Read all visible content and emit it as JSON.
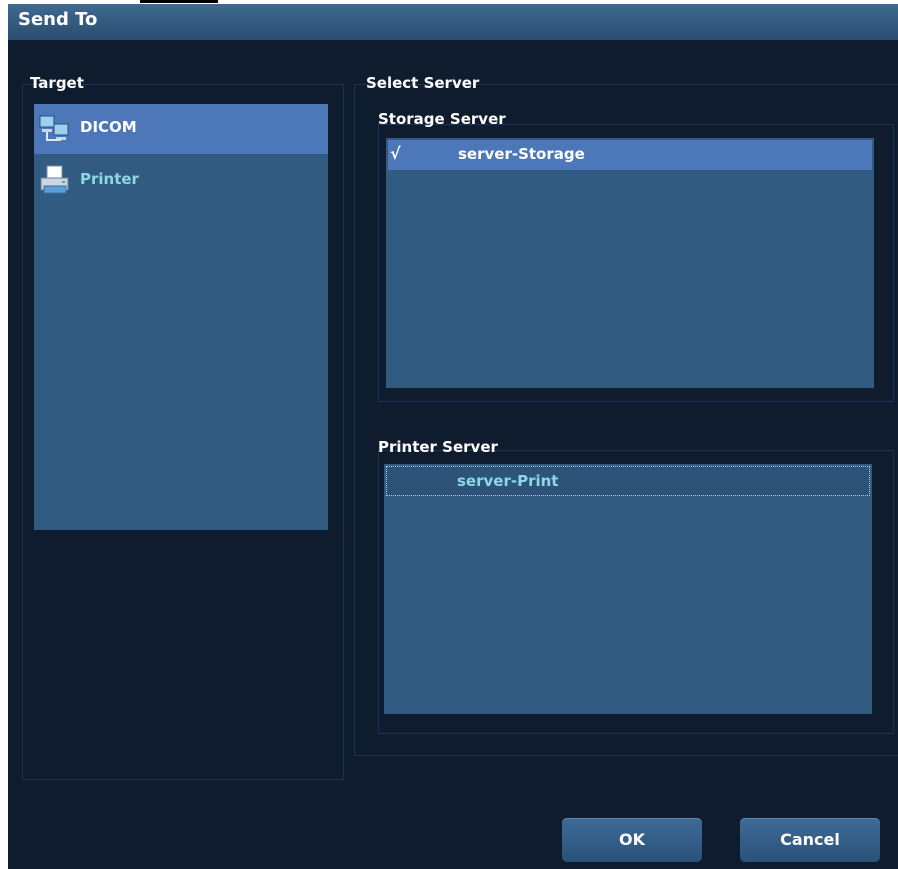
{
  "dialog": {
    "title": "Send To"
  },
  "target": {
    "label": "Target",
    "items": [
      {
        "label": "DICOM",
        "icon": "network-computers-icon",
        "selected": true
      },
      {
        "label": "Printer",
        "icon": "printer-icon",
        "selected": false
      }
    ]
  },
  "select_server": {
    "label": "Select Server",
    "storage": {
      "label": "Storage Server",
      "rows": [
        {
          "check": "√",
          "name": "server-Storage"
        }
      ]
    },
    "printer": {
      "label": "Printer Server",
      "rows": [
        {
          "check": "",
          "name": "server-Print"
        }
      ]
    }
  },
  "buttons": {
    "ok": "OK",
    "cancel": "Cancel"
  },
  "colors": {
    "background": "#0e1c2e",
    "list_bg": "#325b82",
    "selection": "#4c77b9",
    "printer_label": "#8fd6e6"
  }
}
